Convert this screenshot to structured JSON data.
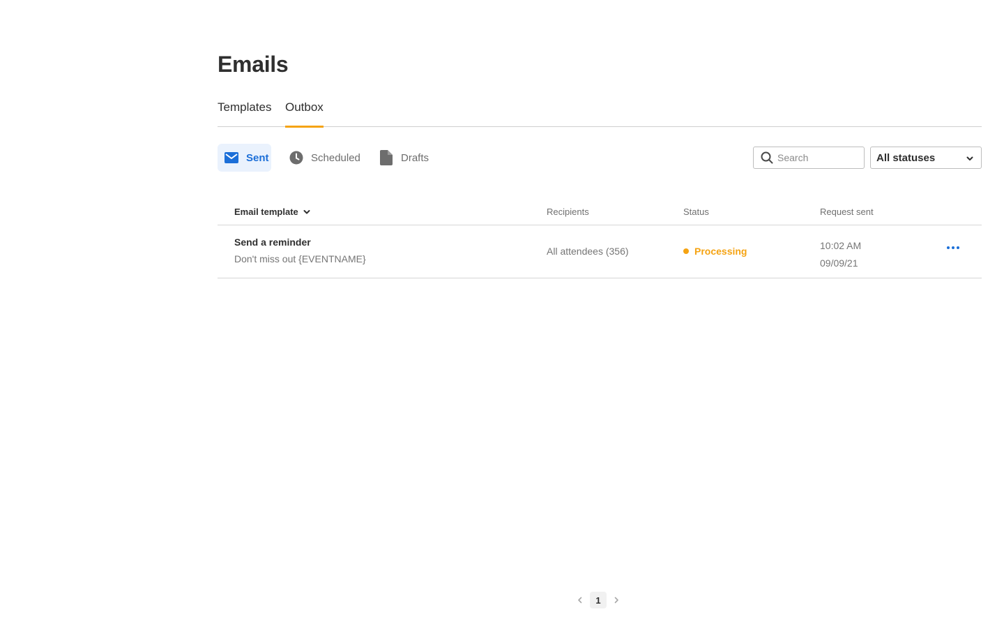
{
  "page": {
    "title": "Emails"
  },
  "tabs": [
    {
      "label": "Templates",
      "active": false
    },
    {
      "label": "Outbox",
      "active": true
    }
  ],
  "subtabs": [
    {
      "label": "Sent",
      "icon": "envelope-icon",
      "active": true
    },
    {
      "label": "Scheduled",
      "icon": "clock-icon",
      "active": false
    },
    {
      "label": "Drafts",
      "icon": "document-icon",
      "active": false
    }
  ],
  "search": {
    "placeholder": "Search",
    "value": ""
  },
  "status_filter": {
    "value": "All statuses"
  },
  "table": {
    "columns": [
      "Email template",
      "Recipients",
      "Status",
      "Request sent"
    ],
    "rows": [
      {
        "title": "Send a reminder",
        "subject": "Don't miss out {EVENTNAME}",
        "recipients": "All attendees (356)",
        "status": "Processing",
        "time": "10:02 AM",
        "date": "09/09/21"
      }
    ]
  },
  "pagination": {
    "current_page": "1"
  },
  "colors": {
    "accent_orange": "#f5a312",
    "link_blue": "#1c6fd8",
    "active_subtab_bg": "#eaf2fd"
  }
}
